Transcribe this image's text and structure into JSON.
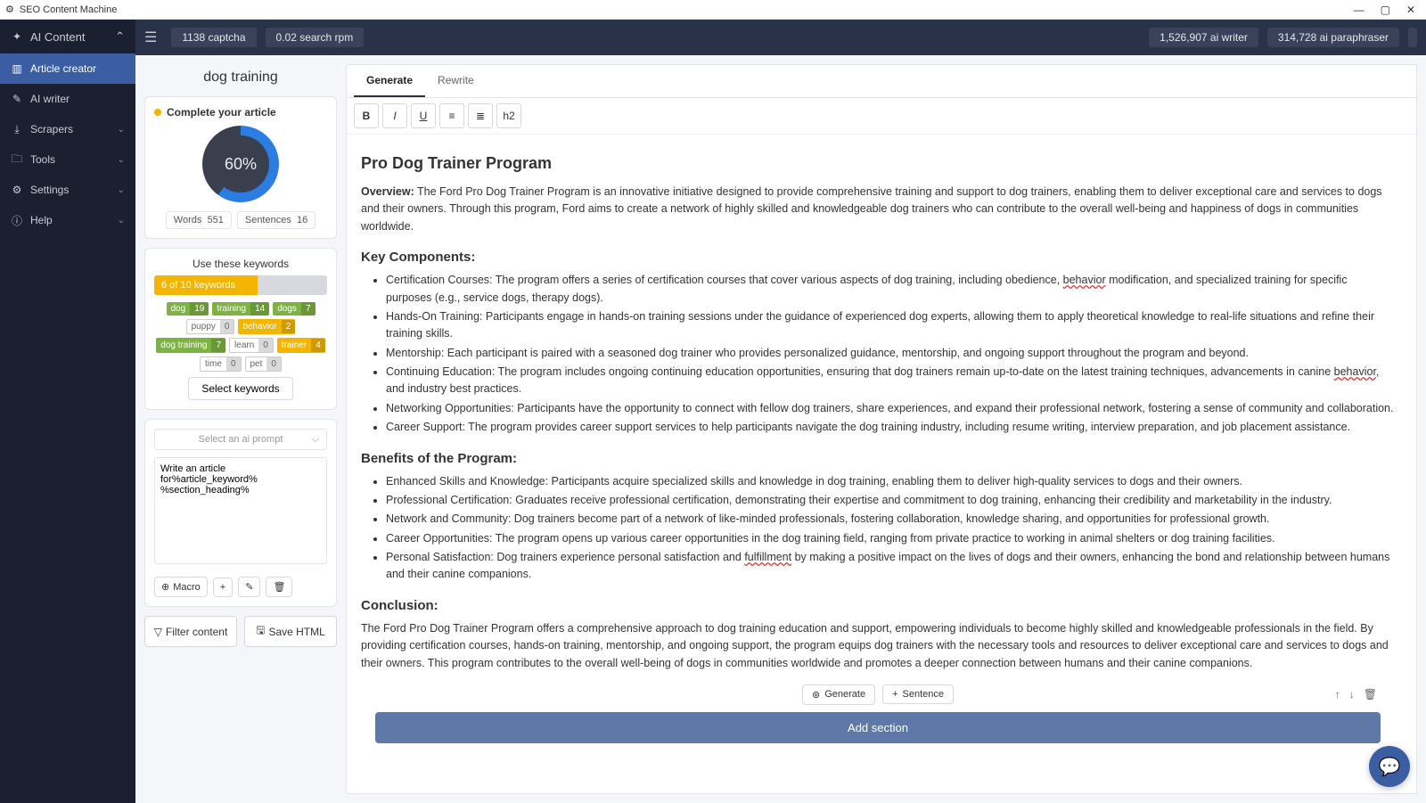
{
  "window": {
    "title": "SEO Content Machine"
  },
  "sidebar": {
    "header": "AI Content",
    "items": [
      {
        "icon": "▥",
        "label": "Article creator"
      },
      {
        "icon": "✎",
        "label": "AI writer"
      },
      {
        "icon": "⤓",
        "label": "Scrapers",
        "chev": true
      },
      {
        "icon": "🗀",
        "label": "Tools",
        "chev": true
      },
      {
        "icon": "⚙",
        "label": "Settings",
        "chev": true
      },
      {
        "icon": "ⓘ",
        "label": "Help",
        "chev": true
      }
    ]
  },
  "topbar": {
    "captcha": "1138 captcha",
    "searchrpm": "0.02 search rpm",
    "aiwriter": "1,526,907 ai writer",
    "aiparaphraser": "314,728 ai paraphraser"
  },
  "project": {
    "title": "dog training",
    "completeLabel": "Complete your article",
    "percent": "60%",
    "wordsLabel": "Words",
    "words": "551",
    "sentLabel": "Sentences",
    "sent": "16"
  },
  "keywords": {
    "title": "Use these keywords",
    "bar": "6 of 10 keywords",
    "tags": [
      {
        "t": "dog",
        "n": "19",
        "c": "green"
      },
      {
        "t": "training",
        "n": "14",
        "c": "green"
      },
      {
        "t": "dogs",
        "n": "7",
        "c": "green"
      },
      {
        "t": "puppy",
        "n": "0",
        "c": "plain"
      },
      {
        "t": "behavior",
        "n": "2",
        "c": "orange"
      },
      {
        "t": "dog training",
        "n": "7",
        "c": "green"
      },
      {
        "t": "learn",
        "n": "0",
        "c": "plain"
      },
      {
        "t": "trainer",
        "n": "4",
        "c": "orange"
      },
      {
        "t": "time",
        "n": "0",
        "c": "plain"
      },
      {
        "t": "pet",
        "n": "0",
        "c": "plain"
      }
    ],
    "selectBtn": "Select keywords"
  },
  "prompt": {
    "selectPlaceholder": "Select an ai prompt",
    "text": "Write an article for%article_keyword% %section_heading%",
    "macro": "Macro"
  },
  "actions": {
    "filter": "Filter content",
    "save": "Save HTML"
  },
  "tabs": {
    "generate": "Generate",
    "rewrite": "Rewrite"
  },
  "toolbar": {
    "b": "B",
    "i": "I",
    "u": "U",
    "ul": "≡",
    "ol": "≣",
    "h2": "h2"
  },
  "article": {
    "h1": "Pro Dog Trainer Program",
    "overviewLabel": "Overview:",
    "overview": " The Ford Pro Dog Trainer Program is an innovative initiative designed to provide comprehensive training and support to dog trainers, enabling them to deliver exceptional care and services to dogs and their owners. Through this program, Ford aims to create a network of highly skilled and knowledgeable dog trainers who can contribute to the overall well-being and happiness of dogs in communities worldwide.",
    "kc": "Key Components:",
    "kc1a": "Certification Courses: The program offers a series of certification courses that cover various aspects of dog training, including obedience, ",
    "kc1b": "behavior",
    "kc1c": " modification, and specialized training for specific purposes (e.g., service dogs, therapy dogs).",
    "kc2": "Hands-On Training: Participants engage in hands-on training sessions under the guidance of experienced dog experts, allowing them to apply theoretical knowledge to real-life situations and refine their training skills.",
    "kc3": "Mentorship: Each participant is paired with a seasoned dog trainer who provides personalized guidance, mentorship, and ongoing support throughout the program and beyond.",
    "kc4a": "Continuing Education: The program includes ongoing continuing education opportunities, ensuring that dog trainers remain up-to-date on the latest training techniques, advancements in canine ",
    "kc4b": "behavior",
    "kc4c": ", and industry best practices.",
    "kc5": "Networking Opportunities: Participants have the opportunity to connect with fellow dog trainers, share experiences, and expand their professional network, fostering a sense of community and collaboration.",
    "kc6": "Career Support: The program provides career support services to help participants navigate the dog training industry, including resume writing, interview preparation, and job placement assistance.",
    "ben": "Benefits of the Program:",
    "b1": "Enhanced Skills and Knowledge: Participants acquire specialized skills and knowledge in dog training, enabling them to deliver high-quality services to dogs and their owners.",
    "b2": "Professional Certification: Graduates receive professional certification, demonstrating their expertise and commitment to dog training, enhancing their credibility and marketability in the industry.",
    "b3": "Network and Community: Dog trainers become part of a network of like-minded professionals, fostering collaboration, knowledge sharing, and opportunities for professional growth.",
    "b4": "Career Opportunities: The program opens up various career opportunities in the dog training field, ranging from private practice to working in animal shelters or dog training facilities.",
    "b5a": "Personal Satisfaction: Dog trainers experience personal satisfaction and ",
    "b5b": "fulfillment",
    "b5c": " by making a positive impact on the lives of dogs and their owners, enhancing the bond and relationship between humans and their canine companions.",
    "con": "Conclusion:",
    "conText": "The Ford Pro Dog Trainer Program offers a comprehensive approach to dog training education and support, empowering individuals to become highly skilled and knowledgeable professionals in the field. By providing certification courses, hands-on training, mentorship, and ongoing support, the program equips dog trainers with the necessary tools and resources to deliver exceptional care and services to dogs and their owners. This program contributes to the overall well-being of dogs in communities worldwide and promotes a deeper connection between humans and their canine companions."
  },
  "sectionActions": {
    "generate": "Generate",
    "sentence": "Sentence",
    "add": "Add section"
  }
}
